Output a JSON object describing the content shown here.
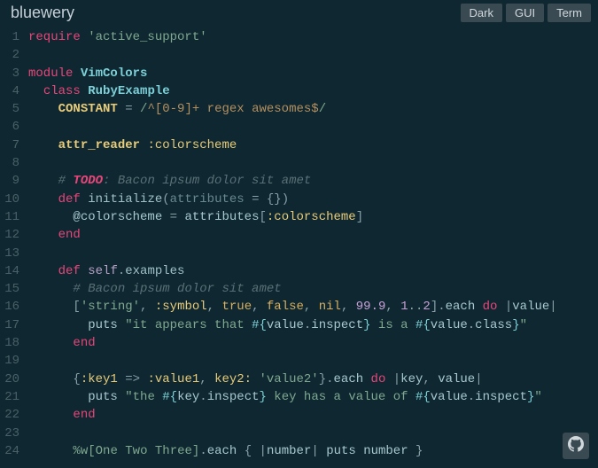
{
  "header": {
    "title": "bluewery",
    "buttons": {
      "dark": "Dark",
      "gui": "GUI",
      "term": "Term"
    }
  },
  "code": {
    "l1": {
      "require": "require",
      "sp": " ",
      "str": "'active_support'"
    },
    "l3": {
      "module": "module",
      "sp": " ",
      "name": "VimColors"
    },
    "l4": {
      "indent": "  ",
      "class": "class",
      "sp": " ",
      "name": "RubyExample"
    },
    "l5": {
      "indent": "    ",
      "const": "CONSTANT",
      "eq": " = ",
      "d1": "/",
      "body": "^[0-9]+ regex awesomes$",
      "d2": "/"
    },
    "l7": {
      "indent": "    ",
      "attr": "attr_reader",
      "sp": " ",
      "sym": ":colorscheme"
    },
    "l8": {
      "indent": "    ",
      "hash": "# ",
      "todo": "TODO",
      "rest": ": Bacon ipsum dolor sit amet"
    },
    "l9": {
      "indent": "    ",
      "def": "def",
      "sp": " ",
      "name": "initialize",
      "lp": "(",
      "arg": "attributes",
      "eq": " = ",
      "lb": "{",
      "rb": "}",
      "rp": ")"
    },
    "l10": {
      "indent": "      ",
      "ivar": "@colorscheme",
      "eq": " = ",
      "id": "attributes",
      "lb": "[",
      "sym": ":colorscheme",
      "rb": "]"
    },
    "l11": {
      "indent": "    ",
      "end": "end"
    },
    "l14": {
      "indent": "    ",
      "def": "def",
      "sp": " ",
      "self": "self",
      "dot": ".",
      "name": "examples"
    },
    "l15": {
      "indent": "      ",
      "cmt": "# Bacon ipsum dolor sit amet"
    },
    "l16": {
      "indent": "      ",
      "lb": "[",
      "str": "'string'",
      "c1": ", ",
      "sym": ":symbol",
      "c2": ", ",
      "t": "true",
      "c3": ", ",
      "f": "false",
      "c4": ", ",
      "nil": "nil",
      "c5": ", ",
      "n1": "99.9",
      "c6": ", ",
      "n2": "1",
      "dots": "..",
      "n3": "2",
      "rb": "]",
      "dot": ".",
      "each": "each",
      "sp": " ",
      "do": "do",
      "sp2": " ",
      "p1": "|",
      "v": "value",
      "p2": "|"
    },
    "l17": {
      "indent": "        ",
      "puts": "puts",
      "sp": " ",
      "q1": "\"",
      "s1": "it appears that ",
      "i1o": "#{",
      "v1": "value",
      "d1": ".",
      "m1": "inspect",
      "i1c": "}",
      "s2": " is a ",
      "i2o": "#{",
      "v2": "value",
      "d2": ".",
      "m2": "class",
      "i2c": "}",
      "q2": "\""
    },
    "l18": {
      "indent": "      ",
      "end": "end"
    },
    "l20": {
      "indent": "      ",
      "lb": "{",
      "k1": ":key1",
      "ar": " => ",
      "v1": ":value1",
      "c1": ", ",
      "k2": "key2:",
      "sp": " ",
      "v2": "'value2'",
      "rb": "}",
      "dot": ".",
      "each": "each",
      "sp2": " ",
      "do": "do",
      "sp3": " ",
      "p1": "|",
      "a1": "key",
      "c2": ", ",
      "a2": "value",
      "p2": "|"
    },
    "l21": {
      "indent": "        ",
      "puts": "puts",
      "sp": " ",
      "q1": "\"",
      "s1": "the ",
      "i1o": "#{",
      "v1": "key",
      "d1": ".",
      "m1": "inspect",
      "i1c": "}",
      "s2": " key has a value of ",
      "i2o": "#{",
      "v2": "value",
      "d2": ".",
      "m2": "inspect",
      "i2c": "}",
      "q2": "\""
    },
    "l22": {
      "indent": "      ",
      "end": "end"
    },
    "l24": {
      "indent": "      ",
      "pw": "%w[",
      "w1": "One",
      "sp1": " ",
      "w2": "Two",
      "sp2": " ",
      "w3": "Three",
      "rb": "]",
      "dot": ".",
      "each": "each",
      "sp": " ",
      "lb": "{",
      "sp3": " ",
      "p1": "|",
      "a": "number",
      "p2": "|",
      "sp4": " ",
      "puts": "puts",
      "sp5": " ",
      "id": "number",
      "sp6": " ",
      "cb": "}"
    }
  },
  "gutter": [
    "1",
    "2",
    "3",
    "4",
    "5",
    "6",
    "7",
    "8",
    "9",
    "10",
    "11",
    "12",
    "13",
    "14",
    "15",
    "16",
    "17",
    "18",
    "19",
    "20",
    "21",
    "22",
    "23",
    "24"
  ]
}
